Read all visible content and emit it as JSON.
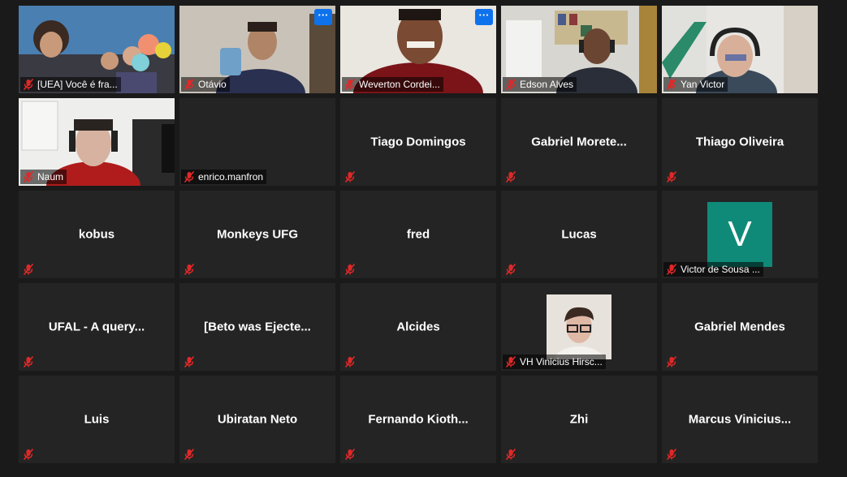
{
  "participants": [
    {
      "name": "[UEA] Você é fra...",
      "tile": "video"
    },
    {
      "name": "Otávio",
      "tile": "video"
    },
    {
      "name": "Weverton Cordei...",
      "tile": "video"
    },
    {
      "name": "Edson Alves",
      "tile": "video"
    },
    {
      "name": "Yan Victor",
      "tile": "video"
    },
    {
      "name": "Naum",
      "tile": "video"
    },
    {
      "name": "enrico.manfron",
      "tile": "dark"
    },
    {
      "name": "Tiago Domingos",
      "tile": "name"
    },
    {
      "name": "Gabriel  Morete...",
      "tile": "name"
    },
    {
      "name": "Thiago Oliveira",
      "tile": "name"
    },
    {
      "name": "kobus",
      "tile": "name"
    },
    {
      "name": "Monkeys UFG",
      "tile": "name"
    },
    {
      "name": "fred",
      "tile": "name"
    },
    {
      "name": "Lucas",
      "tile": "name"
    },
    {
      "name": "Victor de Sousa ...",
      "tile": "avatar",
      "avatar_letter": "V"
    },
    {
      "name": "UFAL - A query...",
      "tile": "name"
    },
    {
      "name": "[Beto was Ejecte...",
      "tile": "name"
    },
    {
      "name": "Alcides",
      "tile": "name"
    },
    {
      "name": "VH Vinicius Hirsc...",
      "tile": "photo"
    },
    {
      "name": "Gabriel Mendes",
      "tile": "name"
    },
    {
      "name": "Luis",
      "tile": "name"
    },
    {
      "name": "Ubiratan Neto",
      "tile": "name"
    },
    {
      "name": "Fernando  Kioth...",
      "tile": "name"
    },
    {
      "name": "Zhi",
      "tile": "name"
    },
    {
      "name": "Marcus  Vinicius...",
      "tile": "name"
    }
  ],
  "more_options_label": "···",
  "colors": {
    "background": "#1a1a1a",
    "tile": "#242424",
    "muted_mic": "#e02828",
    "more_button": "#0e72ed",
    "avatar": "#0f8a78"
  },
  "icons": {
    "muted": "mic-muted-icon",
    "more": "more-options-icon"
  }
}
